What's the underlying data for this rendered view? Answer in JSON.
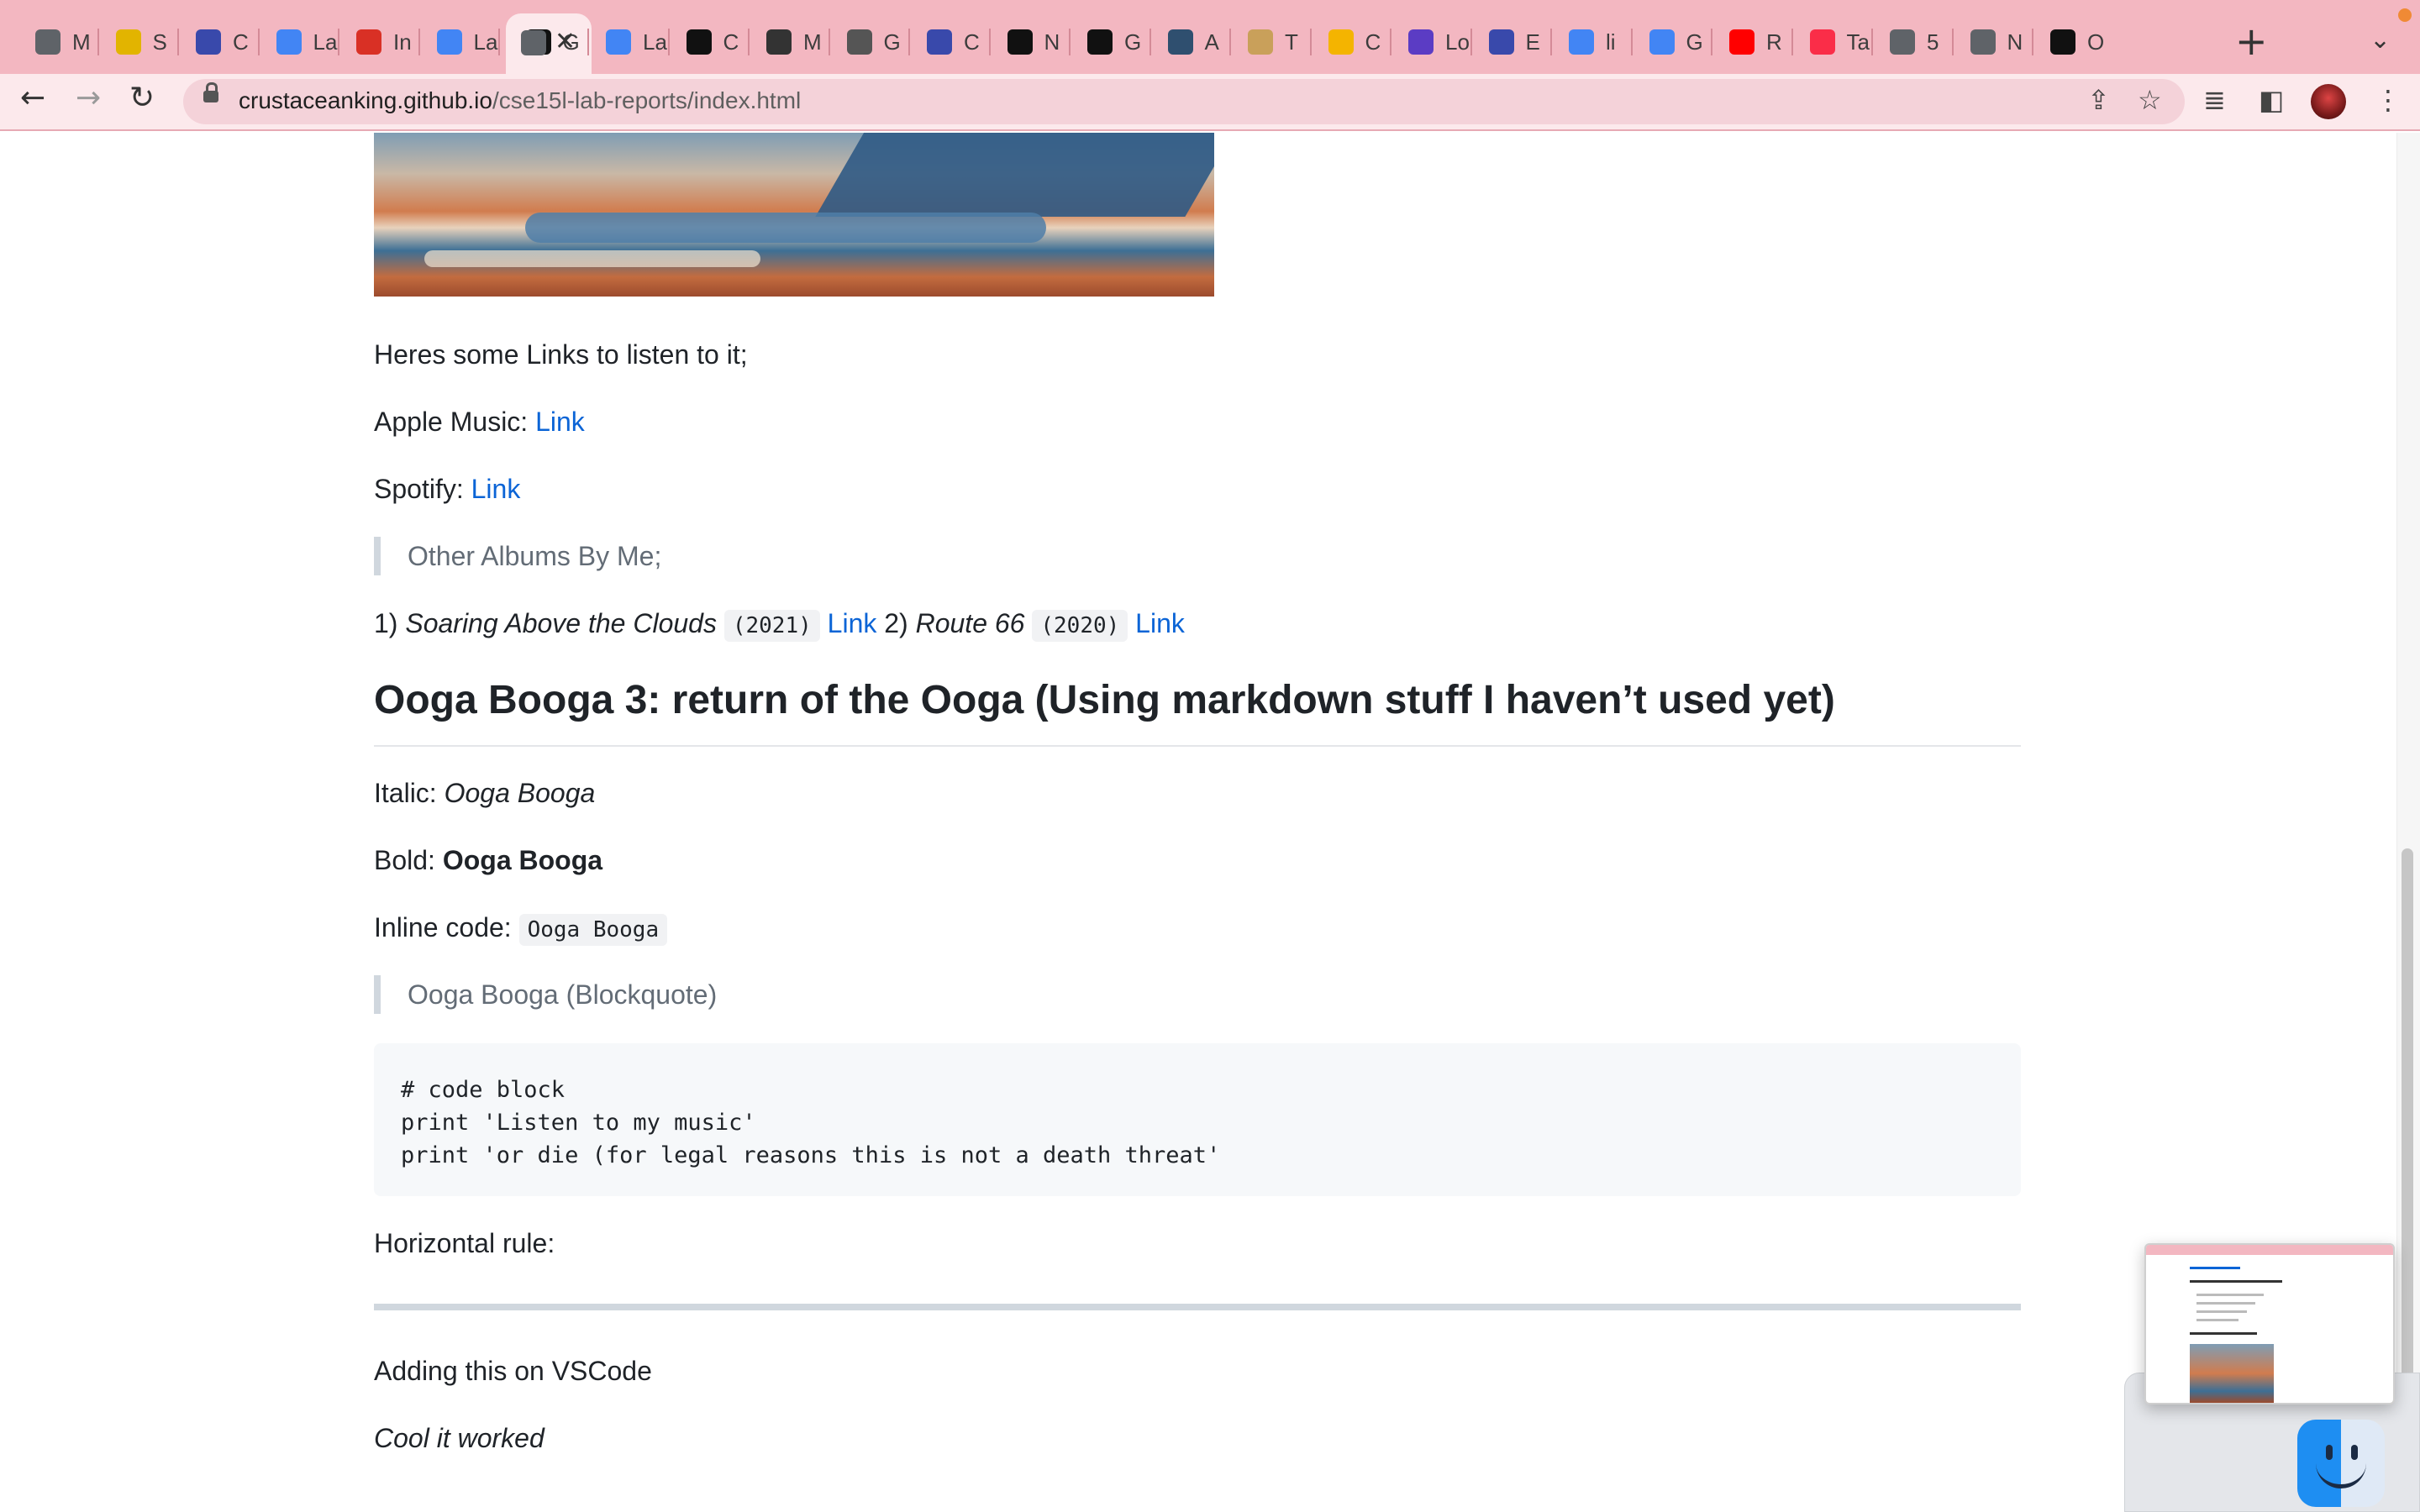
{
  "browser": {
    "tabs": [
      {
        "icon": "chrome-globe-icon",
        "title": "M",
        "color": "#5f6368"
      },
      {
        "icon": "notes-app-icon",
        "title": "S",
        "color": "#e2b400"
      },
      {
        "icon": "classroom-icon",
        "title": "C",
        "color": "#3949ab"
      },
      {
        "icon": "google-docs-icon",
        "title": "La",
        "color": "#4285f4"
      },
      {
        "icon": "gmail-icon",
        "title": "In",
        "color": "#d93025"
      },
      {
        "icon": "google-docs-icon",
        "title": "La",
        "color": "#4285f4"
      },
      {
        "icon": "github-icon",
        "title": "G",
        "color": "#111111"
      },
      {
        "icon": "google-docs-icon",
        "title": "La",
        "color": "#4285f4"
      },
      {
        "icon": "github-icon",
        "title": "C",
        "color": "#111111"
      },
      {
        "icon": "markdown-icon",
        "title": "M",
        "color": "#333333"
      },
      {
        "icon": "markdown-icon",
        "title": "G",
        "color": "#555555"
      },
      {
        "icon": "classroom-icon",
        "title": "C",
        "color": "#3949ab"
      },
      {
        "icon": "github-icon",
        "title": "N",
        "color": "#111111"
      },
      {
        "icon": "github-icon",
        "title": "G",
        "color": "#111111"
      },
      {
        "icon": "tds-icon",
        "title": "A",
        "color": "#2f4f6f"
      },
      {
        "icon": "jar-icon",
        "title": "T",
        "color": "#c9a05a"
      },
      {
        "icon": "slides-icon",
        "title": "C",
        "color": "#f4b400"
      },
      {
        "icon": "list-app-icon",
        "title": "Lo",
        "color": "#5b3cc4"
      },
      {
        "icon": "classroom-icon",
        "title": "E",
        "color": "#3949ab"
      },
      {
        "icon": "google-g-icon",
        "title": "li",
        "color": "#4285f4"
      },
      {
        "icon": "google-docs-icon",
        "title": "G",
        "color": "#4285f4"
      },
      {
        "icon": "youtube-icon",
        "title": "R",
        "color": "#ff0000"
      },
      {
        "icon": "apple-music-icon",
        "title": "Ta",
        "color": "#fa2d48"
      },
      {
        "icon": "chrome-globe-icon",
        "title": "5",
        "color": "#5f6368"
      },
      {
        "icon": "chrome-icon",
        "title": "N",
        "color": "#5f6368"
      },
      {
        "icon": "github-icon",
        "title": "O",
        "color": "#111111"
      }
    ],
    "active_tab_icon": "chrome-globe-icon",
    "url_host": "crustaceanking.github.io",
    "url_path": "/cse15l-lab-reports/index.html"
  },
  "page": {
    "listen_intro": "Heres some Links to listen to it;",
    "apple_music_label": "Apple Music: ",
    "apple_music_link": "Link",
    "spotify_label": "Spotify: ",
    "spotify_link": "Link",
    "other_albums_quote": "Other Albums By Me;",
    "albums_line": {
      "n1": "1) ",
      "album1": "Soaring Above the Clouds",
      "year1": "(2021)",
      "link1": "Link",
      "n2": " 2) ",
      "album2": "Route 66",
      "year2": "(2020)",
      "link2": "Link"
    },
    "heading": "Ooga Booga 3: return of the Ooga (Using markdown stuff I haven’t used yet)",
    "italic_label": "Italic: ",
    "italic_value": "Ooga Booga",
    "bold_label": "Bold: ",
    "bold_value": "Ooga Booga",
    "inline_code_label": "Inline code: ",
    "inline_code_value": "Ooga Booga",
    "blockquote": "Ooga Booga (Blockquote)",
    "code_lines": [
      "# code block",
      "print 'Listen to my music'",
      "print 'or die (for legal reasons this is not a death threat'"
    ],
    "hr_label": "Horizontal rule:",
    "vscode_line": "Adding this on VSCode",
    "worked_line": "Cool it worked"
  },
  "colors": {
    "tabstrip": "#f3b7c1",
    "toolbar": "#fce9ec",
    "link": "#0b64d6"
  }
}
